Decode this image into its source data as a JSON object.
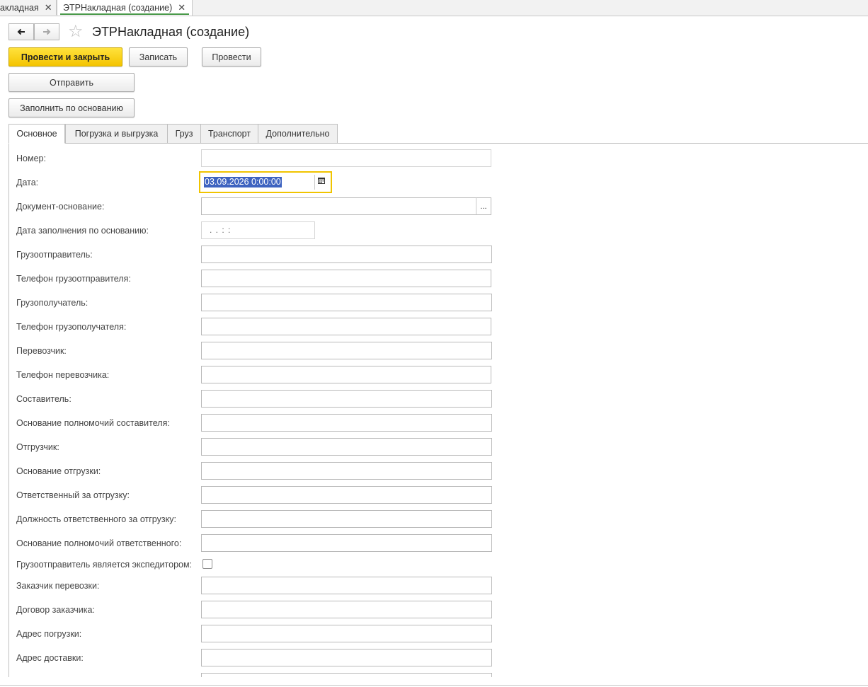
{
  "window_tabs": [
    {
      "label": "акладная",
      "close": "✕"
    },
    {
      "label": "ЭТРНакладная (создание)",
      "close": "✕"
    }
  ],
  "header": {
    "back_icon": "arrow-left-icon",
    "forward_icon": "arrow-right-icon",
    "favorite_icon": "star-icon",
    "title": "ЭТРНакладная (создание)"
  },
  "toolbar": {
    "post_and_close": "Провести и закрыть",
    "save": "Записать",
    "post": "Провести",
    "send": "Отправить",
    "fill_by_basis": "Заполнить по основанию"
  },
  "tabs": [
    {
      "label": "Основное",
      "active": true
    },
    {
      "label": "Погрузка и выгрузка",
      "active": false
    },
    {
      "label": "Груз",
      "active": false
    },
    {
      "label": "Транспорт",
      "active": false
    },
    {
      "label": "Дополнительно",
      "active": false
    }
  ],
  "form": {
    "number_label": "Номер:",
    "number_value": "",
    "date_label": "Дата:",
    "date_value": "03.09.2026  0:00:00",
    "calendar_icon": "calendar-icon",
    "basis_doc_label": "Документ-основание:",
    "basis_doc_value": "",
    "select_button": "...",
    "fill_date_label": "Дата заполнения по основанию:",
    "fill_date_mask": ".  .       :  :",
    "shipper_label": "Грузоотправитель:",
    "shipper_phone_label": "Телефон грузоотправителя:",
    "consignee_label": "Грузополучатель:",
    "consignee_phone_label": "Телефон грузополучателя:",
    "carrier_label": "Перевозчик:",
    "carrier_phone_label": "Телефон перевозчика:",
    "author_label": "Составитель:",
    "author_authority_label": "Основание полномочий составителя:",
    "loader_label": "Отгрузчик:",
    "shipment_basis_label": "Основание отгрузки:",
    "responsible_label": "Ответственный за отгрузку:",
    "responsible_position_label": "Должность ответственного за отгрузку:",
    "responsible_authority_label": "Основание полномочий ответственного:",
    "shipper_forwarder_label": "Грузоотправитель является экспедитором:",
    "shipper_forwarder_checked": false,
    "customer_label": "Заказчик перевозки:",
    "customer_contract_label": "Договор заказчика:",
    "loading_address_label": "Адрес погрузки:",
    "delivery_address_label": "Адрес доставки:"
  },
  "colors": {
    "primary_button": "#f4c400",
    "active_field_border": "#f0c400",
    "selection": "#3e63c0",
    "active_tab_underline": "#4a9a4a"
  }
}
